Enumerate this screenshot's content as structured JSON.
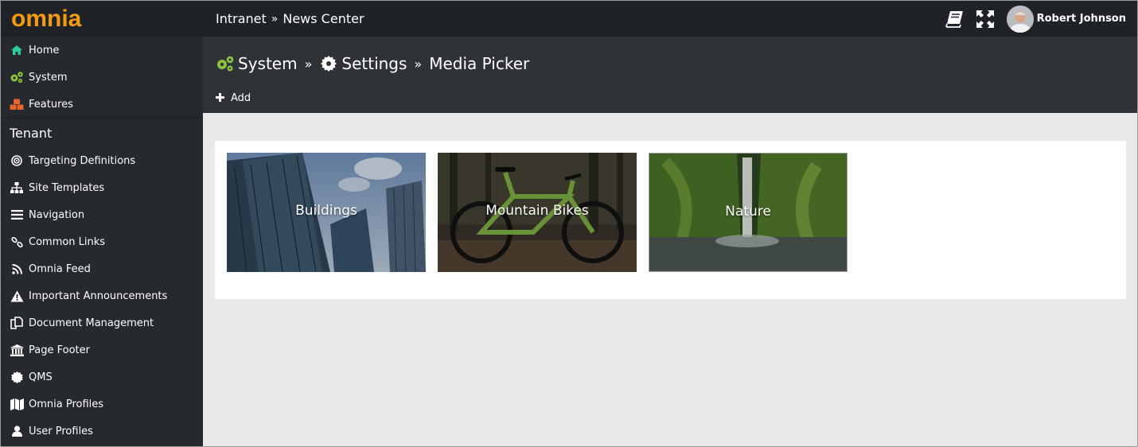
{
  "app": {
    "logo_text": "omnia",
    "accent": "#f39c12"
  },
  "topbar": {
    "breadcrumb": [
      "Intranet",
      "News Center"
    ],
    "separator": "»",
    "user_name": "Robert Johnson",
    "icons": [
      "book-icon",
      "expand-icon"
    ]
  },
  "sidebar": {
    "top_items": [
      {
        "label": "Home",
        "icon": "home-icon"
      },
      {
        "label": "System",
        "icon": "cogs-icon"
      },
      {
        "label": "Features",
        "icon": "cubes-icon"
      }
    ],
    "section_title": "Tenant",
    "items": [
      {
        "label": "Targeting Definitions",
        "icon": "target-icon"
      },
      {
        "label": "Site Templates",
        "icon": "sitemap-icon"
      },
      {
        "label": "Navigation",
        "icon": "bars-icon"
      },
      {
        "label": "Common Links",
        "icon": "link-icon"
      },
      {
        "label": "Omnia Feed",
        "icon": "rss-icon"
      },
      {
        "label": "Important Announcements",
        "icon": "warning-icon"
      },
      {
        "label": "Document Management",
        "icon": "documents-icon"
      },
      {
        "label": "Page Footer",
        "icon": "bank-icon"
      },
      {
        "label": "QMS",
        "icon": "certificate-icon"
      },
      {
        "label": "Omnia Profiles",
        "icon": "map-icon"
      },
      {
        "label": "User Profiles",
        "icon": "user-icon"
      }
    ]
  },
  "header": {
    "breadcrumb": [
      {
        "label": "System",
        "icon": "cogs-icon"
      },
      {
        "label": "Settings",
        "icon": "gear-icon"
      },
      {
        "label": "Media Picker",
        "icon": ""
      }
    ],
    "separator": "»",
    "add_label": "Add"
  },
  "media": {
    "tiles": [
      {
        "label": "Buildings"
      },
      {
        "label": "Mountain Bikes"
      },
      {
        "label": "Nature"
      }
    ]
  }
}
